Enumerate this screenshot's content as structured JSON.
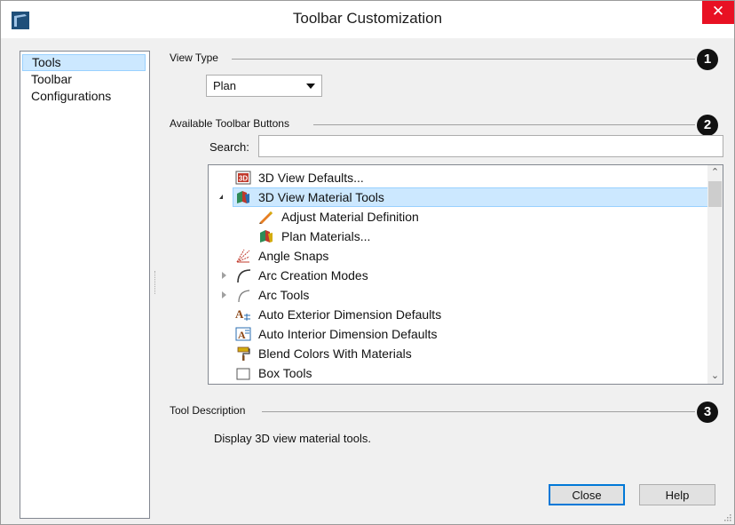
{
  "window": {
    "title": "Toolbar Customization",
    "close_glyph": "✕",
    "accent_close": "#e81123"
  },
  "sidebar": {
    "items": [
      {
        "label": "Tools",
        "selected": true
      },
      {
        "label": "Toolbar",
        "selected": false
      },
      {
        "label": "Configurations",
        "selected": false
      }
    ]
  },
  "view_type": {
    "group_label": "View Type",
    "badge": "1",
    "selected": "Plan"
  },
  "available": {
    "group_label": "Available Toolbar Buttons",
    "badge": "2",
    "search_label": "Search:",
    "search_value": ""
  },
  "tree": {
    "items": [
      {
        "label": "3D View Defaults...",
        "icon": "3d-view-defaults-icon",
        "level": 0,
        "expander": "none",
        "selected": false
      },
      {
        "label": "3D View Material Tools",
        "icon": "material-tools-icon",
        "level": 0,
        "expander": "expanded",
        "selected": true
      },
      {
        "label": "Adjust Material Definition",
        "icon": "adjust-material-icon",
        "level": 1,
        "expander": "none",
        "selected": false
      },
      {
        "label": "Plan Materials...",
        "icon": "plan-materials-icon",
        "level": 1,
        "expander": "none",
        "selected": false
      },
      {
        "label": "Angle Snaps",
        "icon": "angle-snaps-icon",
        "level": 0,
        "expander": "none",
        "selected": false
      },
      {
        "label": "Arc Creation Modes",
        "icon": "arc-icon",
        "level": 0,
        "expander": "collapsed",
        "selected": false
      },
      {
        "label": "Arc Tools",
        "icon": "arc-tools-icon",
        "level": 0,
        "expander": "collapsed",
        "selected": false
      },
      {
        "label": "Auto Exterior Dimension Defaults",
        "icon": "exterior-dimension-icon",
        "level": 0,
        "expander": "none",
        "selected": false
      },
      {
        "label": "Auto Interior Dimension Defaults",
        "icon": "interior-dimension-icon",
        "level": 0,
        "expander": "none",
        "selected": false
      },
      {
        "label": "Blend Colors With Materials",
        "icon": "paint-roller-icon",
        "level": 0,
        "expander": "none",
        "selected": false
      },
      {
        "label": "Box Tools",
        "icon": "box-icon",
        "level": 0,
        "expander": "collapsed",
        "selected": false
      }
    ]
  },
  "description": {
    "group_label": "Tool Description",
    "badge": "3",
    "text": "Display 3D view material tools."
  },
  "buttons": {
    "close": "Close",
    "help": "Help"
  }
}
